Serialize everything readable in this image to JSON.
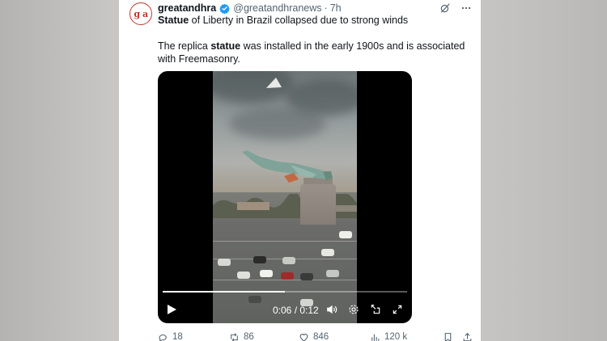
{
  "post": {
    "avatar_text": "g a",
    "author_name": "greatandhra",
    "author_handle": "@greatandhranews",
    "separator": "·",
    "timestamp": "7h",
    "line1_bold": "Statue",
    "line1_rest": " of Liberty in Brazil collapsed due to strong winds",
    "body_pre": "The replica ",
    "body_bold": "statue",
    "body_post": " was installed in the early 1900s and is associated with Freemasonry."
  },
  "header_icons": [
    "grok-icon",
    "more-icon"
  ],
  "video": {
    "current_time": "0:06",
    "separator": " / ",
    "duration": "0:12",
    "progress": 0.5,
    "controls": [
      "play-icon",
      "volume-icon",
      "settings-icon",
      "pip-icon",
      "fullscreen-icon"
    ]
  },
  "actions": {
    "replies": "18",
    "reposts": "86",
    "likes": "846",
    "views": "120 k"
  },
  "colors": {
    "text": "#0f1419",
    "secondary": "#536471",
    "verified": "#1d9bf0",
    "avatar_red": "#c0392b"
  }
}
